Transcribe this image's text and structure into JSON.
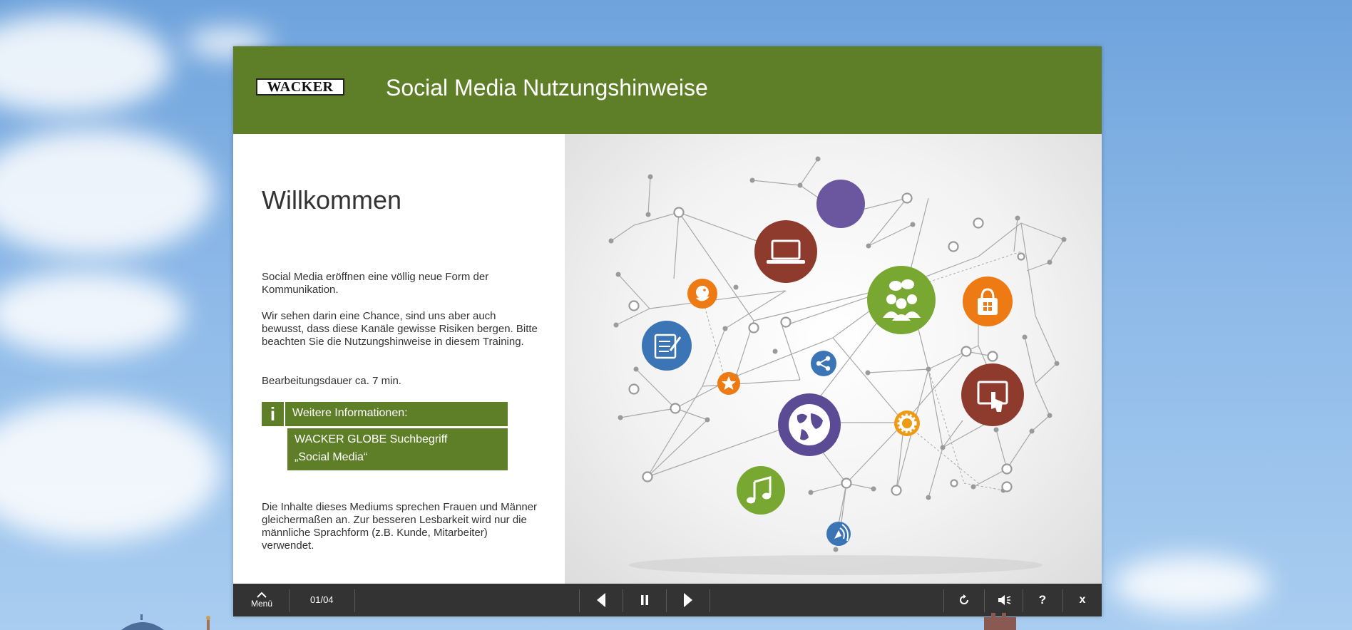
{
  "header": {
    "logo_text": "WACKER",
    "title": "Social Media Nutzungshinweise"
  },
  "slide": {
    "heading": "Willkommen",
    "para1": "Social Media eröffnen eine völlig neue Form der Kommunikation.",
    "para2": "Wir sehen darin eine Chance, sind uns aber auch bewusst, dass diese Kanäle gewisse Risiken bergen. Bitte beachten Sie die Nutzungshinweise in diesem Training.",
    "para3": "Bearbeitungsdauer ca. 7 min.",
    "info": {
      "icon_text": "i",
      "title": "Weitere Informationen:",
      "line1": "WACKER GLOBE Suchbegriff",
      "line2": "„Social Media“"
    },
    "para4": "Die Inhalte dieses Mediums sprechen Frauen und Männer gleichermaßen an. Zur besseren Lesbarkeit wird nur die männliche Sprachform (z.B. Kunde, Mitarbeiter) verwendet."
  },
  "toolbar": {
    "menu_label": "Menü",
    "page_indicator": "01/04",
    "help_label": "?",
    "close_label": "x"
  },
  "colors": {
    "brand_green": "#5e7f27",
    "toolbar_bg": "#333333"
  },
  "icons": {
    "network_nodes": [
      "bird-icon",
      "notepad-icon",
      "star-icon",
      "laptop-icon",
      "people-icon",
      "shopping-bag-icon",
      "share-icon",
      "globe-icon",
      "gear-icon",
      "touchscreen-icon",
      "music-icon",
      "broadcast-icon"
    ]
  }
}
